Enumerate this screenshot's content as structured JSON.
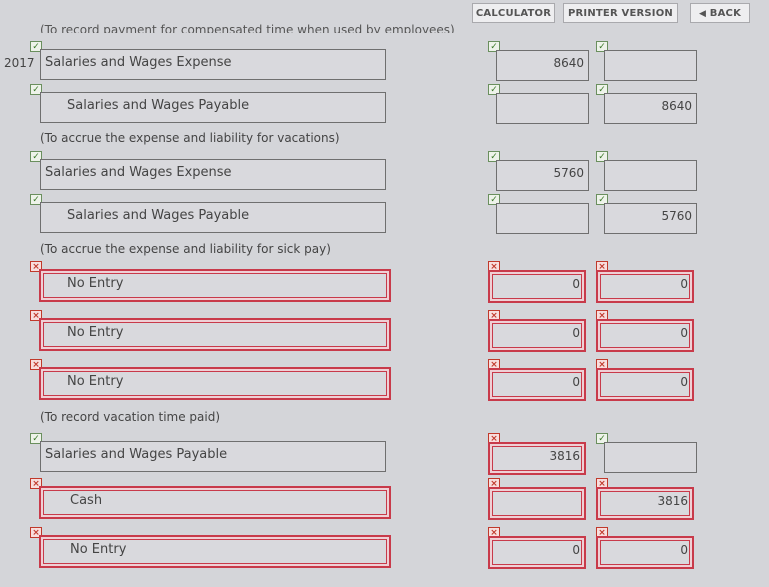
{
  "toolbar": {
    "calculator_label": "CALCULATOR",
    "printer_label": "PRINTER VERSION",
    "back_label": "BACK",
    "back_icon": "chevron-left-icon"
  },
  "cut_note": "(To record payment for compensated time when used by employees)",
  "year": "2017",
  "rows": [
    {
      "account": "Salaries and Wages Expense",
      "debit": "8640",
      "credit": "",
      "status": [
        "ok",
        "ok",
        "ok"
      ]
    },
    {
      "account": "Salaries and Wages Payable",
      "debit": "",
      "credit": "8640",
      "status": [
        "ok",
        "ok",
        "ok"
      ]
    },
    {
      "account": "Salaries and Wages Expense",
      "debit": "5760",
      "credit": "",
      "status": [
        "ok",
        "ok",
        "ok"
      ]
    },
    {
      "account": "Salaries and Wages Payable",
      "debit": "",
      "credit": "5760",
      "status": [
        "ok",
        "ok",
        "ok"
      ]
    },
    {
      "account": "No Entry",
      "debit": "0",
      "credit": "0",
      "status": [
        "bad",
        "bad",
        "bad"
      ]
    },
    {
      "account": "No Entry",
      "debit": "0",
      "credit": "0",
      "status": [
        "bad",
        "bad",
        "bad"
      ]
    },
    {
      "account": "No Entry",
      "debit": "0",
      "credit": "0",
      "status": [
        "bad",
        "bad",
        "bad"
      ]
    },
    {
      "account": "Salaries and Wages Payable",
      "debit": "3816",
      "credit": "",
      "status": [
        "ok",
        "bad",
        "ok"
      ]
    },
    {
      "account": "Cash",
      "debit": "",
      "credit": "3816",
      "status": [
        "bad",
        "bad",
        "bad"
      ]
    },
    {
      "account": "No Entry",
      "debit": "0",
      "credit": "0",
      "status": [
        "bad",
        "bad",
        "bad"
      ]
    }
  ],
  "notes": [
    "(To accrue the expense and liability for vacations)",
    "(To accrue the expense and liability for sick pay)",
    "(To record vacation time paid)"
  ],
  "marks": {
    "ok": "✓",
    "bad": "×"
  }
}
